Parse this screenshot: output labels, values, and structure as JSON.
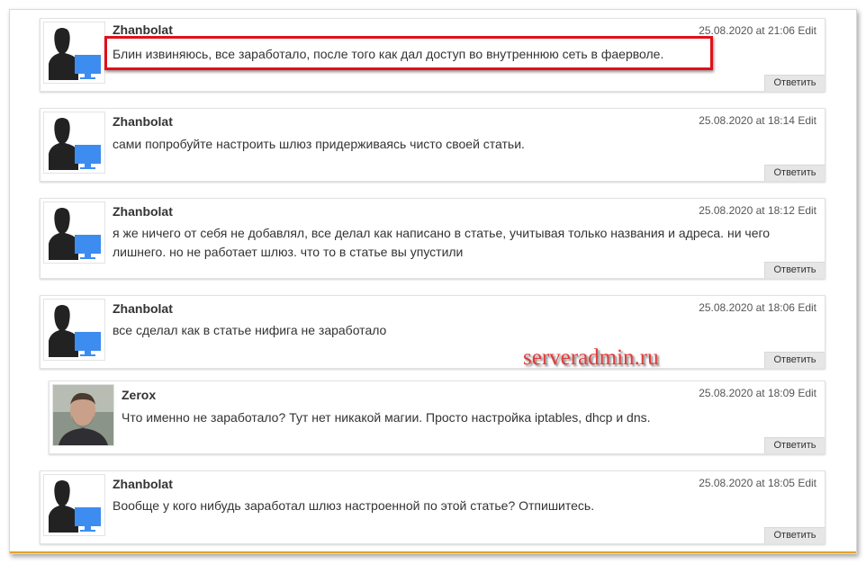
{
  "watermark": "serveradmin.ru",
  "comments": [
    {
      "author": "Zhanbolat",
      "date": "25.08.2020 at 21:06",
      "edit": "Edit",
      "text": "Блин извиняюсь, все заработало, после того как дал доступ во внутреннюю сеть в фаерволе.",
      "reply": "Ответить",
      "avatar": "default-user-icon"
    },
    {
      "author": "Zhanbolat",
      "date": "25.08.2020 at 18:14",
      "edit": "Edit",
      "text": "сами попробуйте настроить шлюз придерживаясь чисто своей статьи.",
      "reply": "Ответить",
      "avatar": "default-user-icon"
    },
    {
      "author": "Zhanbolat",
      "date": "25.08.2020 at 18:12",
      "edit": "Edit",
      "text_line1": "я же ничего от себя не добавлял, все делал как написано в статье, учитывая только названия и адреса. ни чего",
      "text_line2": "лишнего. но не работает шлюз. что то в статье вы упустили",
      "reply": "Ответить",
      "avatar": "default-user-icon"
    },
    {
      "author": "Zhanbolat",
      "date": "25.08.2020 at 18:06",
      "edit": "Edit",
      "text": "все сделал как в статье нифига не заработало",
      "reply": "Ответить",
      "avatar": "default-user-icon"
    },
    {
      "author": "Zerox",
      "date": "25.08.2020 at 18:09",
      "edit": "Edit",
      "text": "Что именно не заработало? Тут нет никакой магии. Просто настройка iptables, dhcp и dns.",
      "reply": "Ответить",
      "avatar": "user-photo"
    },
    {
      "author": "Zhanbolat",
      "date": "25.08.2020 at 18:05",
      "edit": "Edit",
      "text": "Вообще у кого нибудь заработал шлюз настроенной по этой статье? Отпишитесь.",
      "reply": "Ответить",
      "avatar": "default-user-icon"
    }
  ]
}
